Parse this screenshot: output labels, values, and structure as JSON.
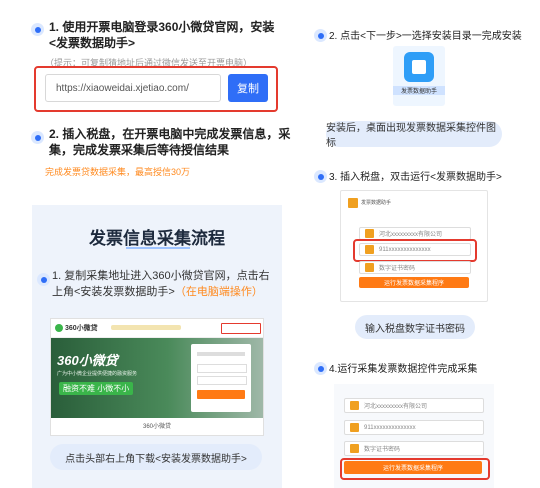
{
  "left": {
    "step1": {
      "line1": "1. 使用开票电脑登录360小微贷官网，安装",
      "line2": "<发票数据助手>",
      "hint": "（提示：可复制猜地址后通过微信发送至开票电脑）",
      "url": "https://xiaoweidai.xjetiao.com/",
      "copy_label": "复制"
    },
    "step2": {
      "line1": "2. 插入税盘，在开票电脑中完成发票信息，采",
      "line2": "集，完成发票采集后等待授信结果",
      "orange": "完成发票贷数据采集，最高授信30万"
    },
    "flow": {
      "title": "发票信息采集流程",
      "step1_line1": "1. 复制采集地址进入360小微贷官网，点击右",
      "step1_line2": "上角<安装发票数据助手>",
      "step1_note": "（在电脑端操作）",
      "site": {
        "logo": "360小微贷",
        "hero_text": "360小微贷",
        "hero_sub": "广为中小微企业提供便捷的融资服务",
        "slogan": "融资不难 小微不小",
        "caption": "360小微贷"
      },
      "pill": "点击头部右上角下载<安装发票数据助手>"
    }
  },
  "right": {
    "step2": {
      "label": "2. 点击<下一步>一选择安装目录一完成安装",
      "app_label": "发票数据助手",
      "pill": "安装后，桌面出现发票数据采集控件图标"
    },
    "step3": {
      "label": "3. 插入税盘，双击运行<发票数据助手>",
      "card_title": "发票数据助手",
      "field1": "河北xxxxxxxxx有限公司",
      "field2": "911xxxxxxxxxxxxxx",
      "field3": "数字证书密码",
      "button": "运行发票数据采集程序",
      "pill": "输入税盘数字证书密码"
    },
    "step4": {
      "label": "4.运行采集发票数据控件完成采集",
      "field1": "河北xxxxxxxxx有限公司",
      "field2": "911xxxxxxxxxxxxxx",
      "field3": "数字证书密码",
      "button": "运行发票数据采集程序"
    }
  },
  "colors": {
    "accent": "#2f6ef7",
    "orange": "#ff7a14",
    "red": "#e43a2e"
  }
}
